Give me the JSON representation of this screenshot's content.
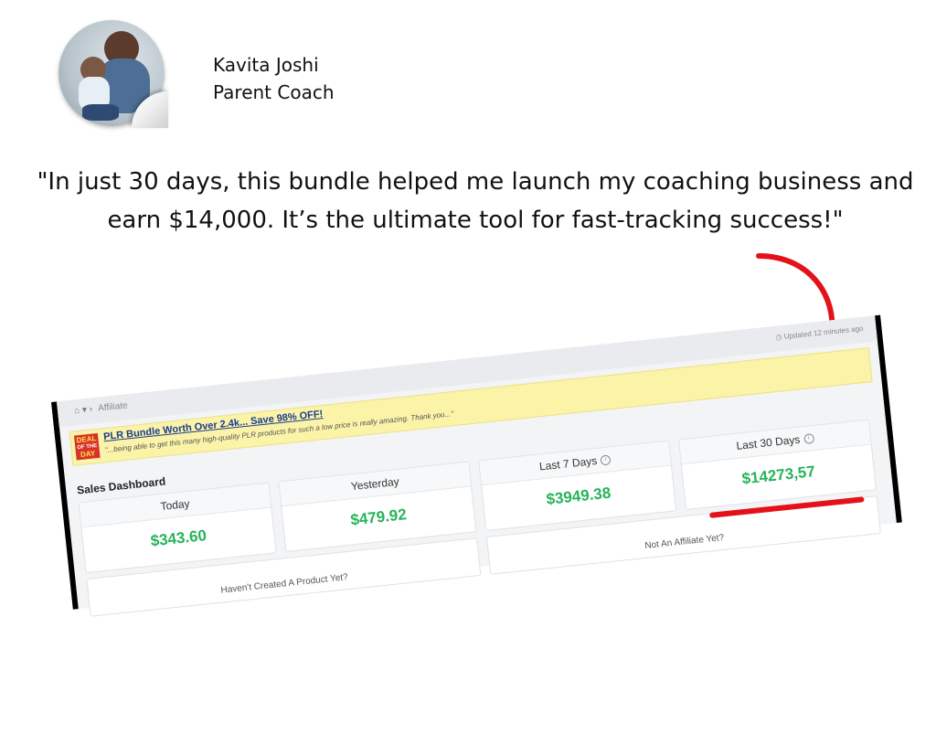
{
  "author": {
    "name": "Kavita Joshi",
    "role": "Parent Coach"
  },
  "quote": "\"In just 30 days, this bundle helped me launch my coaching business and earn $14,000. It’s the ultimate tool for fast-tracking success!\"",
  "screenshot": {
    "breadcrumb": "Affiliate",
    "updated": "Updated 12 minutes ago",
    "promo": {
      "badge_top": "DEAL",
      "badge_mid": "OF THE",
      "badge_bottom": "DAY",
      "title": "PLR Bundle Worth Over 2.4k... Save 98% OFF!",
      "subtitle": "\"...being able to get this many high-quality PLR products for such a low price is really amazing. Thank you...\""
    },
    "dashboard_title": "Sales Dashboard",
    "cards": [
      {
        "label": "Today",
        "value": "$343.60"
      },
      {
        "label": "Yesterday",
        "value": "$479.92"
      },
      {
        "label": "Last 7 Days",
        "value": "$3949.38"
      },
      {
        "label": "Last 30 Days",
        "value": "$14273,57"
      }
    ],
    "sub_cards": [
      {
        "label": "Haven't Created A Product Yet?"
      },
      {
        "label": "Not An Affiliate Yet?"
      }
    ]
  },
  "colors": {
    "accent_red": "#e4111a",
    "value_green": "#27b45a",
    "promo_yellow": "#fbf3a8"
  }
}
